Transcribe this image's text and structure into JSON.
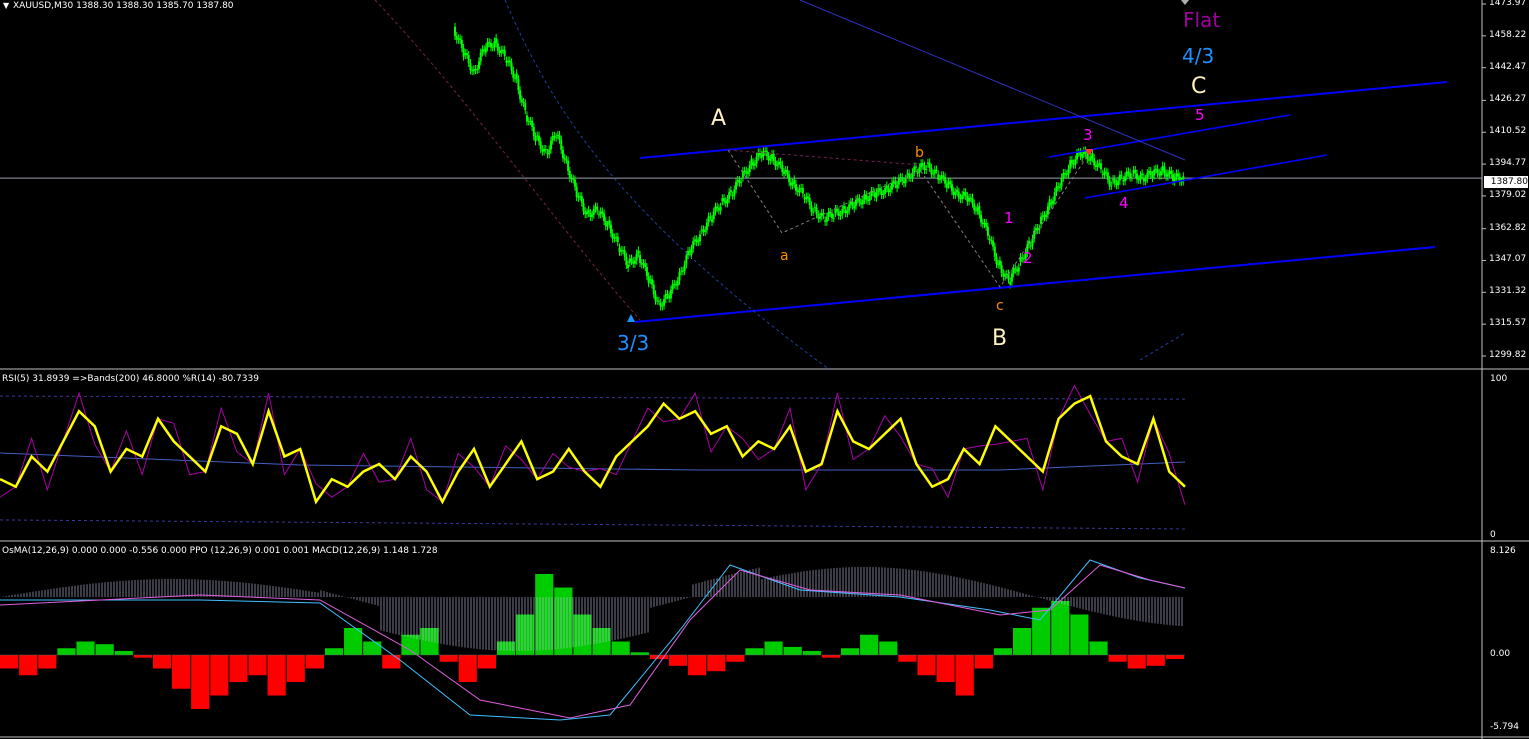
{
  "symbol_header": "XAUUSD,M30  1388.30 1388.30 1385.70 1387.80",
  "current_price_tag": "1387.80",
  "price_axis": [
    "1473.97",
    "1458.22",
    "1442.47",
    "1426.27",
    "1410.52",
    "1394.77",
    "1379.02",
    "1362.82",
    "1347.07",
    "1331.32",
    "1315.57",
    "1299.82"
  ],
  "wave_labels": {
    "flat": "Flat",
    "deg43": "4/3",
    "big_C": "C",
    "big_A": "A",
    "big_B": "B",
    "deg33": "3/3",
    "small_a": "a",
    "small_b": "b",
    "small_c": "c",
    "n1": "1",
    "n2": "2",
    "n3": "3",
    "n4": "4",
    "n5": "5"
  },
  "rsi_title": "RSI(5) 31.8939   =>Bands(200) 46.8000   %R(14) -80.7339",
  "rsi_axis": [
    "100",
    "0"
  ],
  "macd_title": "OsMA(12,26,9) 0.000 0.000 -0.556 0.000   PPO (12,26,9) 0.001 0.001   MACD(12,26,9) 1.148 1.728",
  "macd_axis": [
    "8.126",
    "0.00",
    "-5.794"
  ],
  "colors": {
    "candle": "#00ff00",
    "channel": "#0000ff",
    "rsi_line": "#ffff00",
    "percent_r": "#aa00aa",
    "macd_pos": "#00cc00",
    "macd_neg": "#ff0000",
    "label_white": "#ffffff",
    "label_cream": "#fff0c0",
    "label_orange": "#ff8c00",
    "label_magenta": "#ff00ff",
    "label_purple": "#a000a0",
    "label_cyan": "#1e90ff"
  },
  "chart_data": {
    "type": "candlestick",
    "symbol": "XAUUSD",
    "timeframe": "M30",
    "ylim": [
      1299.82,
      1473.97
    ],
    "last_close": 1387.8,
    "wave_points": [
      {
        "label": "3/3",
        "price": 1322
      },
      {
        "label": "A",
        "price": 1402
      },
      {
        "label": "a",
        "price": 1364
      },
      {
        "label": "b",
        "price": 1394
      },
      {
        "label": "c",
        "price": 1337
      },
      {
        "label": "B",
        "price": 1337
      },
      {
        "label": "1",
        "price": 1370
      },
      {
        "label": "2",
        "price": 1345
      },
      {
        "label": "3",
        "price": 1402
      },
      {
        "label": "4",
        "price": 1384
      },
      {
        "label": "5",
        "price": 1415
      },
      {
        "label": "C",
        "price": 1430
      }
    ],
    "close_series": [
      1462,
      1450,
      1440,
      1452,
      1455,
      1448,
      1438,
      1420,
      1408,
      1400,
      1410,
      1395,
      1380,
      1370,
      1372,
      1365,
      1355,
      1345,
      1350,
      1338,
      1325,
      1330,
      1340,
      1352,
      1360,
      1368,
      1375,
      1380,
      1388,
      1395,
      1400,
      1398,
      1392,
      1385,
      1380,
      1372,
      1368,
      1370,
      1372,
      1375,
      1378,
      1380,
      1382,
      1385,
      1388,
      1392,
      1394,
      1390,
      1385,
      1380,
      1378,
      1372,
      1360,
      1345,
      1337,
      1345,
      1355,
      1365,
      1375,
      1385,
      1395,
      1400,
      1398,
      1392,
      1385,
      1388,
      1390,
      1388,
      1390,
      1392,
      1388,
      1387.8
    ],
    "rsi_series": [
      35,
      30,
      50,
      40,
      60,
      80,
      70,
      40,
      55,
      50,
      75,
      60,
      50,
      40,
      70,
      65,
      45,
      80,
      50,
      55,
      20,
      35,
      30,
      40,
      45,
      35,
      50,
      40,
      20,
      40,
      55,
      30,
      45,
      60,
      35,
      40,
      55,
      40,
      30,
      50,
      60,
      70,
      85,
      75,
      80,
      65,
      70,
      50,
      60,
      55,
      70,
      40,
      45,
      80,
      60,
      55,
      65,
      75,
      45,
      30,
      35,
      55,
      45,
      70,
      60,
      50,
      40,
      75,
      85,
      90,
      60,
      50,
      45,
      75,
      40,
      30
    ],
    "macd_hist_series": [
      -1,
      -1.5,
      -1,
      0.5,
      1,
      0.8,
      0.3,
      -0.2,
      -1,
      -2.5,
      -4,
      -3,
      -2,
      -1.5,
      -3,
      -2,
      -1,
      0.5,
      2,
      1,
      -1,
      1.5,
      2,
      -0.5,
      -2,
      -1,
      1,
      3,
      6,
      5,
      3,
      2,
      1,
      0.2,
      -0.3,
      -0.8,
      -1.5,
      -1.2,
      -0.5,
      0.5,
      1,
      0.6,
      0.3,
      -0.2,
      0.5,
      1.5,
      1,
      -0.5,
      -1.5,
      -2,
      -3,
      -1,
      0.5,
      2,
      3.5,
      4,
      3,
      1,
      -0.5,
      -1,
      -0.8,
      -0.3
    ]
  }
}
